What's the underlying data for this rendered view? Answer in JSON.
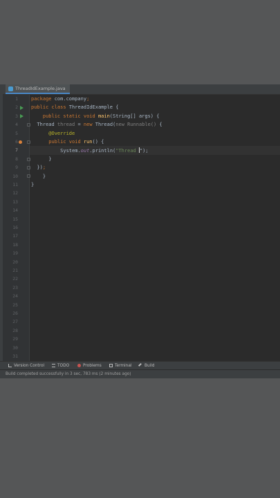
{
  "editor": {
    "tab_label": "ThreadIdExample.java",
    "line_numbers": [
      "1",
      "2",
      "3",
      "4",
      "5",
      "6",
      "7",
      "8",
      "9",
      "10",
      "11",
      "12",
      "13",
      "14",
      "15",
      "16",
      "17",
      "18",
      "19",
      "20",
      "21",
      "22",
      "23",
      "24",
      "25",
      "26",
      "27",
      "28",
      "29",
      "30",
      "31"
    ],
    "current_line": 7,
    "code": [
      [
        {
          "t": "package ",
          "c": "kw"
        },
        {
          "t": "com.company",
          "c": ""
        },
        {
          "t": ";",
          "c": "kw"
        }
      ],
      [
        {
          "t": "public class ",
          "c": "kw"
        },
        {
          "t": "ThreadIdExample {",
          "c": ""
        }
      ],
      [
        {
          "t": "    public static void ",
          "c": "kw"
        },
        {
          "t": "main",
          "c": "fn"
        },
        {
          "t": "(String[] args) {",
          "c": ""
        }
      ],
      [
        {
          "t": "  Thread ",
          "c": ""
        },
        {
          "t": "thread",
          "c": "gr"
        },
        {
          "t": " = ",
          "c": ""
        },
        {
          "t": "new ",
          "c": "kw"
        },
        {
          "t": "Thread(",
          "c": ""
        },
        {
          "t": "new Runnable()",
          "c": "gr"
        },
        {
          "t": " {",
          "c": ""
        }
      ],
      [
        {
          "t": "      @Override",
          "c": "an"
        }
      ],
      [
        {
          "t": "      ",
          "c": ""
        },
        {
          "t": "public void ",
          "c": "kw"
        },
        {
          "t": "run",
          "c": "fn"
        },
        {
          "t": "() {",
          "c": ""
        }
      ],
      [
        {
          "t": "          System.",
          "c": ""
        },
        {
          "t": "out",
          "c": "pu"
        },
        {
          "t": ".println(",
          "c": ""
        },
        {
          "t": "\"Thread ",
          "c": "st"
        },
        {
          "t": "|",
          "c": "caret"
        },
        {
          "t": "\");",
          "c": ""
        }
      ],
      [
        {
          "t": "      }",
          "c": ""
        }
      ],
      [
        {
          "t": "  })",
          "c": ""
        },
        {
          "t": ";",
          "c": "kw"
        }
      ],
      [
        {
          "t": "    }",
          "c": ""
        }
      ],
      [
        {
          "t": "}",
          "c": ""
        }
      ]
    ]
  },
  "bottom_tools": {
    "version_control": "Version Control",
    "todo": "TODO",
    "problems": "Problems",
    "terminal": "Terminal",
    "build": "Build"
  },
  "status": {
    "message": "Build completed successfully in 3 sec, 783 ms (2 minutes ago)"
  },
  "colors": {
    "keyword": "#cc7832",
    "method": "#ffc66d",
    "annotation": "#bbb529",
    "string": "#6a8759",
    "static_field": "#9876aa",
    "run_marker": "#499c54"
  }
}
